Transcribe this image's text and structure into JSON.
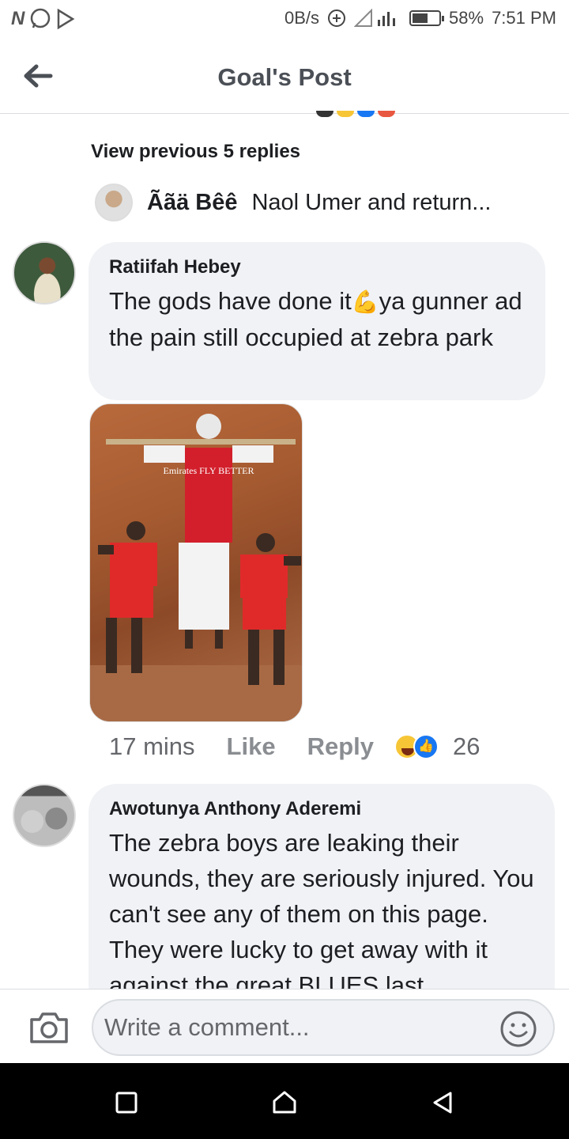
{
  "status_bar": {
    "speed": "0B/s",
    "battery_pct": 58,
    "battery": "58%",
    "time": "7:51 PM",
    "icons": [
      "n-icon",
      "whatsapp-icon",
      "play-store-icon",
      "data-saver-icon",
      "signal-icon",
      "battery-icon"
    ]
  },
  "header": {
    "title": "Goal's Post"
  },
  "thread": {
    "view_previous": "View previous 5 replies",
    "last_reply": {
      "author": "Ããä Bêê",
      "text": "Naol Umer and return..."
    }
  },
  "comments": [
    {
      "author": "Ratiifah Hebey",
      "text_before": "The gods have done it",
      "emoji": "💪",
      "text_after": "ya gunner ad the pain still occupied at zebra park",
      "photo_text": "Emirates FLY BETTER",
      "time": "17 mins",
      "like_label": "Like",
      "reply_label": "Reply",
      "reactions": [
        "haha",
        "like"
      ],
      "reaction_count": "26"
    },
    {
      "author": "Awotunya Anthony Aderemi",
      "text": "The zebra boys are leaking their wounds, they are seriously injured. You can't see any of them on this page. They were lucky to get away with it against the great BLUES last"
    }
  ],
  "composer": {
    "placeholder": "Write a comment..."
  },
  "colors": {
    "bubble": "#f0f2f5",
    "muted": "#65676b",
    "like_blue": "#1877f2",
    "haha_yellow": "#f7c636"
  }
}
